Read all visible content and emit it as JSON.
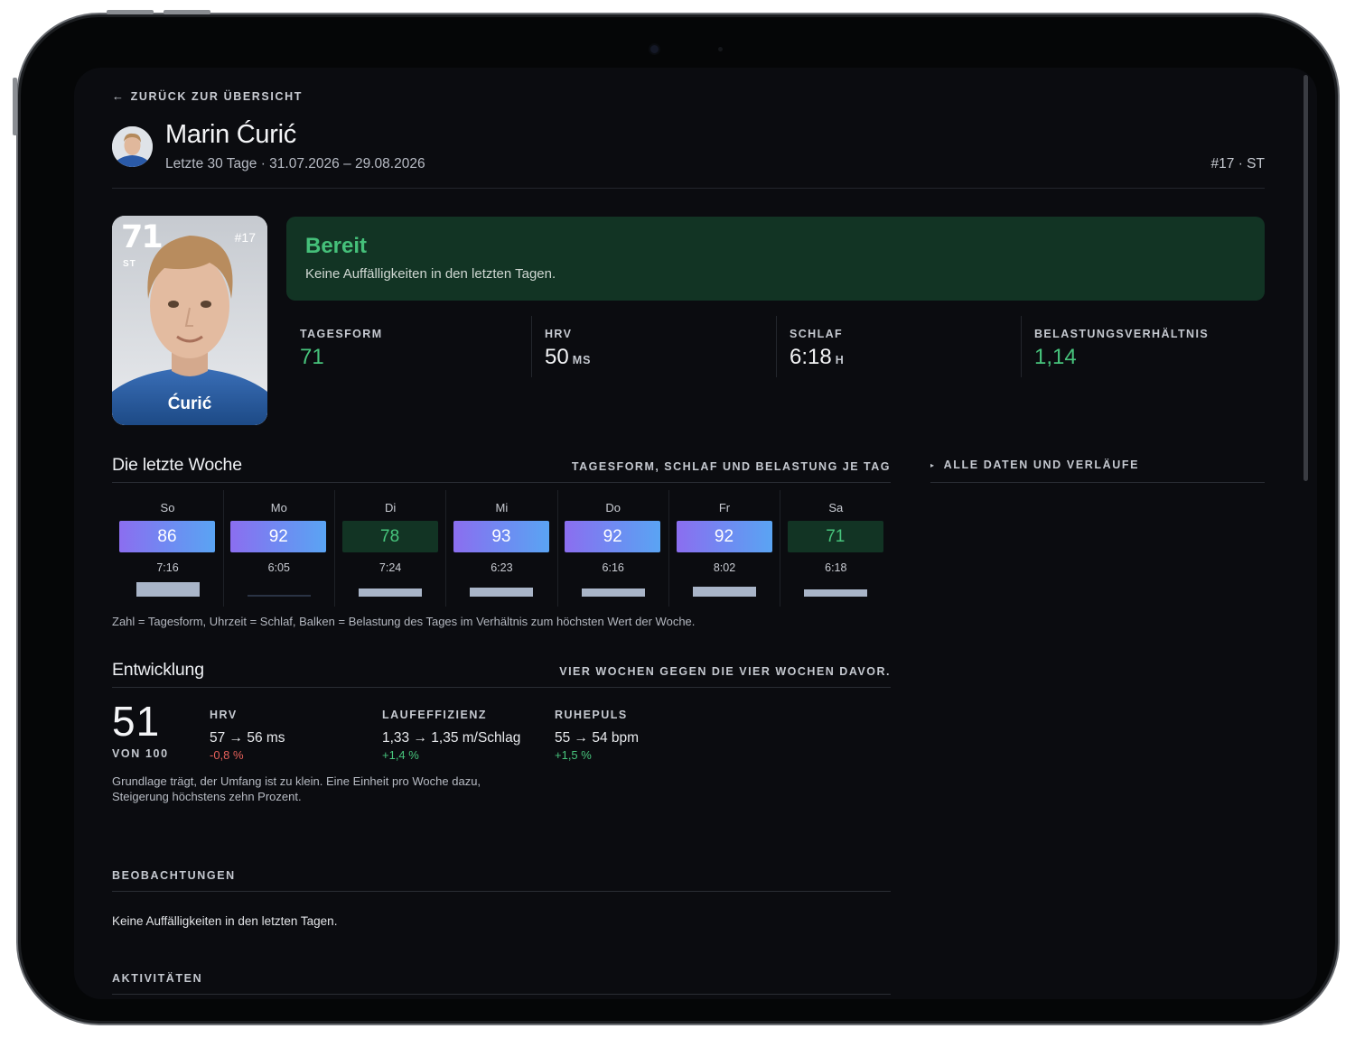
{
  "nav": {
    "back_label": "ZURÜCK ZUR ÜBERSICHT"
  },
  "player": {
    "name": "Marin Ćurić",
    "period": "Letzte 30 Tage · 31.07.2026 – 29.08.2026",
    "jersey_position": "#17 · ST"
  },
  "card": {
    "rating": "71",
    "position": "ST",
    "number": "#17",
    "name": "Ćurić"
  },
  "status": {
    "title": "Bereit",
    "text": "Keine Auffälligkeiten in den letzten Tagen.",
    "color": "#45c07a"
  },
  "metrics": [
    {
      "label": "TAGESFORM",
      "value": "71",
      "unit": ""
    },
    {
      "label": "HRV",
      "value": "50",
      "unit": "MS"
    },
    {
      "label": "SCHLAF",
      "value": "6:18",
      "unit": "H"
    },
    {
      "label": "BELASTUNGSVERHÄLTNIS",
      "value": "1,14",
      "unit": ""
    }
  ],
  "week": {
    "title": "Die letzte Woche",
    "note": "TAGESFORM, SCHLAF UND BELASTUNG JE TAG",
    "days": [
      {
        "day": "So",
        "form": "86",
        "sleep": "7:16",
        "style": "blue",
        "load": 0.98
      },
      {
        "day": "Mo",
        "form": "92",
        "sleep": "6:05",
        "style": "blue",
        "load": 0.12
      },
      {
        "day": "Di",
        "form": "78",
        "sleep": "7:24",
        "style": "green",
        "load": 0.55
      },
      {
        "day": "Mi",
        "form": "93",
        "sleep": "6:23",
        "style": "blue",
        "load": 0.62
      },
      {
        "day": "Do",
        "form": "92",
        "sleep": "6:16",
        "style": "blue",
        "load": 0.55
      },
      {
        "day": "Fr",
        "form": "92",
        "sleep": "8:02",
        "style": "blue",
        "load": 0.68
      },
      {
        "day": "Sa",
        "form": "71",
        "sleep": "6:18",
        "style": "green",
        "load": 0.5
      }
    ],
    "legend": "Zahl = Tagesform, Uhrzeit = Schlaf, Balken = Belastung des Tages im Verhältnis zum höchsten Wert der Woche."
  },
  "side": {
    "all_data_label": "ALLE DATEN UND VERLÄUFE"
  },
  "development": {
    "title": "Entwicklung",
    "note": "VIER WOCHEN GEGEN DIE VIER WOCHEN DAVOR.",
    "score": "51",
    "score_label": "VON 100",
    "columns": [
      {
        "label": "HRV",
        "value": "57 → 56 ms",
        "change": "-0,8 %",
        "trend": "down"
      },
      {
        "label": "LAUFEFFIZIENZ",
        "value": "1,33 → 1,35 m/Schlag",
        "change": "+1,4 %",
        "trend": "up"
      },
      {
        "label": "RUHEPULS",
        "value": "55 → 54 bpm",
        "change": "+1,5 %",
        "trend": "up"
      }
    ],
    "summary": "Grundlage trägt, der Umfang ist zu klein. Eine Einheit pro Woche dazu, Steigerung höchstens zehn Prozent."
  },
  "observations": {
    "title": "BEOBACHTUNGEN",
    "text": "Keine Auffälligkeiten in den letzten Tagen."
  },
  "activities": {
    "title": "AKTIVITÄTEN"
  }
}
